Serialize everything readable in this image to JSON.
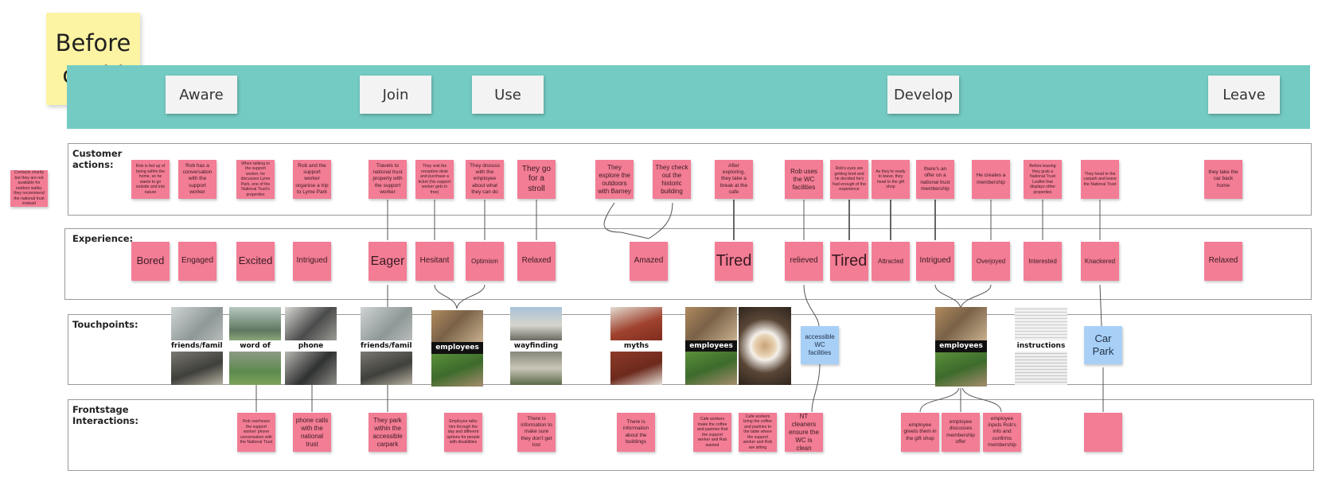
{
  "title_note": "Before\ncovid",
  "phases": [
    "Aware",
    "Join",
    "Use",
    "Develop",
    "Leave"
  ],
  "lanes": {
    "customer_actions": "Customer\nactions:",
    "experience": "Experience:",
    "touchpoints": "Touchpoints:",
    "frontstage": "Frontstage\nInteractions:"
  },
  "stray_note": "Contacts charity but they are not available for outdoor walks; they recommend the national trust instead",
  "actions": [
    "Rob is fed up of being within the home, so he wants to go outside and into nature",
    "Rob has a conversation with the support worker",
    "When talking to the support worker, he discusses Lyme Park, one of the National Trust's properties",
    "Rob and the support worker organise a trip to Lyme Park",
    "Travels to national trust property with the support worker",
    "They visit the reception desk and purchase a ticket (his support worker gets in free)",
    "They discuss with the employee about what they can do",
    "They go for a stroll",
    "They explore the outdoors with Barney",
    "They check out the historic building",
    "After exploring, they take a break at the cafe",
    "Rob uses the WC facilities",
    "Rob's eyes are getting tired and he decided he's had enough of the experience",
    "As they're ready to leave, they head to the gift shop",
    "there's an offer on a national trust membership",
    "He creates a membership",
    "Before leaving they grab a National Trust Leaflet that displays other properties",
    "They head to the carpark and leave the National Trust",
    "they take the car back home"
  ],
  "experiences": [
    "Bored",
    "Engaged",
    "Excited",
    "Intrigued",
    "Eager",
    "Hesitant",
    "Optimism",
    "Relaxed",
    "Amazed",
    "Tired",
    "relieved",
    "Tired",
    "Attracted",
    "Intrigued",
    "Overjoyed",
    "Interested",
    "Knackered",
    "Relaxed"
  ],
  "touchpoints": {
    "friends_family_1": "friends/family",
    "word_of_mouth": "word of mouth",
    "phone": "phone",
    "friends_family_2": "friends/family",
    "employees_1": "employees",
    "wayfinding": "wayfinding",
    "myths": "myths",
    "employees_2": "employees",
    "accessible_wc": "accessible WC facilities",
    "employees_3": "employees",
    "instructions": "instructions",
    "car_park": "Car Park"
  },
  "frontstage": [
    "Rob overhears the support worker' phone conversation with the National Trust",
    "phone calls with the national trust",
    "They park within the accessible carpark",
    "Employee talks him through the day and different options for people with disabilities",
    "There is information to make sure they don't get lost",
    "There is information about the buildings",
    "Cafe workers make the coffee and pastries that the support worker and Rob wanted",
    "Cafe workers bring the coffee and pastries to the table where the support worker and Rob are sitting",
    "NT cleaners ensure the WC is clean",
    "employee greets them in the gift shop",
    "employee discusses membership offer",
    "employee inputs Rob's info and confirms membership",
    ""
  ],
  "colors": {
    "phase_band": "#74cbc3",
    "sticky_pink": "#f27d95",
    "sticky_blue": "#a8d0f7",
    "title_yellow": "#fdf4a3"
  }
}
